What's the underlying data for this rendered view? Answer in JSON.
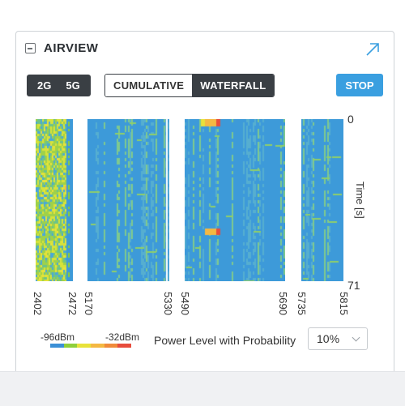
{
  "title": "AIRVIEW",
  "icons": {
    "collapse": "collapse-minus-icon",
    "popout": "popout-arrow-icon"
  },
  "band_buttons": [
    "2G",
    "5G"
  ],
  "mode_buttons": [
    {
      "label": "CUMULATIVE",
      "active": false
    },
    {
      "label": "WATERFALL",
      "active": true
    }
  ],
  "stop_label": "STOP",
  "time_axis": {
    "top": "0",
    "bottom": "71",
    "label": "Time [s]"
  },
  "freq_labels": [
    "2402",
    "2472",
    "5170",
    "5330",
    "5490",
    "5690",
    "5735",
    "5815"
  ],
  "legend": {
    "min": "-96dBm",
    "max": "-32dBm",
    "colors": [
      "#3b8fd6",
      "#8fcf3a",
      "#e8e23a",
      "#f4b842",
      "#f08a3a",
      "#e74c3c"
    ]
  },
  "probability": {
    "label": "Power Level with Probability",
    "value": "10%"
  },
  "colors": {
    "accent": "#3a9fe0",
    "dark": "#3a3f44",
    "waterfall_base": "#3d9ad9"
  }
}
